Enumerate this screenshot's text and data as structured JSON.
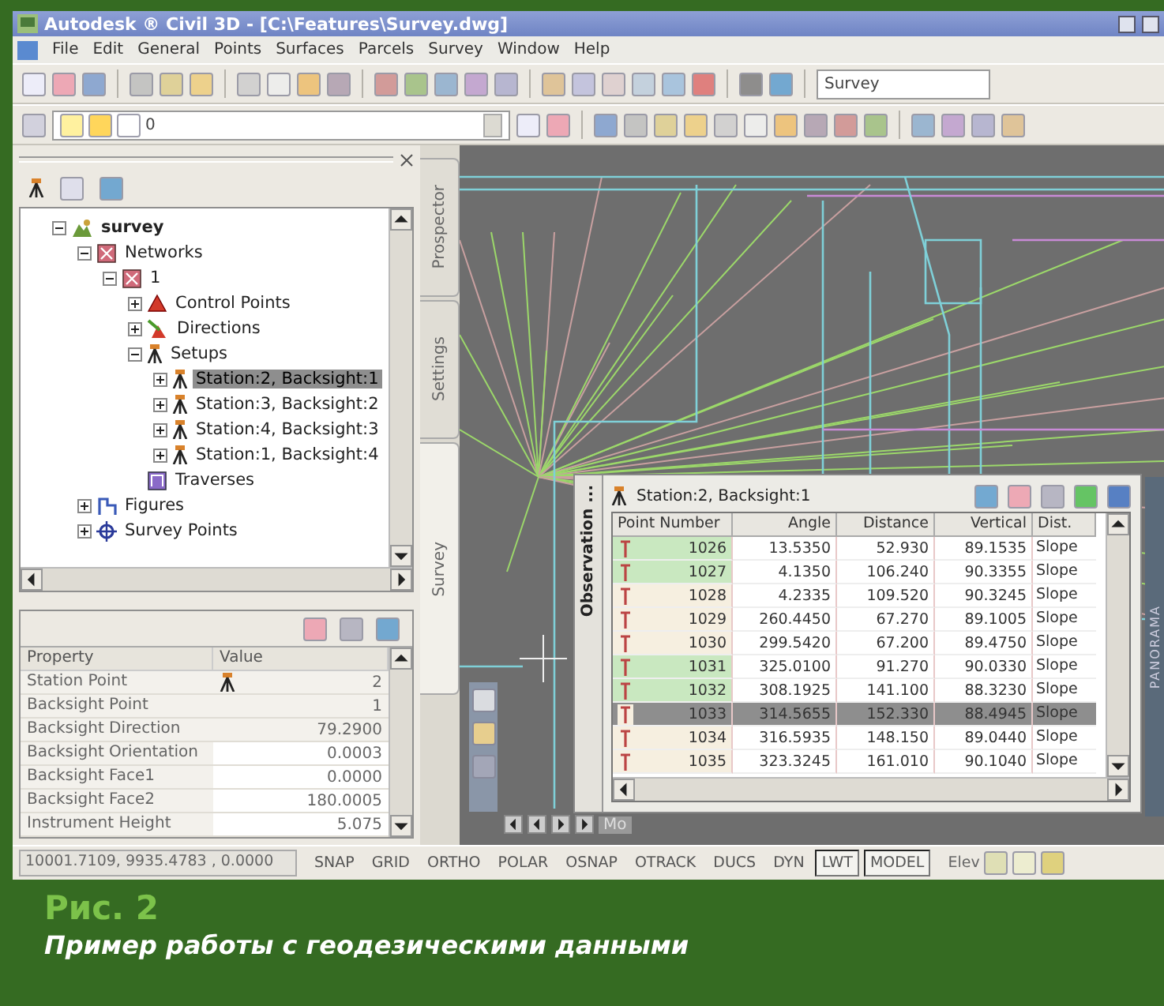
{
  "window": {
    "title": "Autodesk ® Civil 3D - [C:\\Features\\Survey.dwg]"
  },
  "menu": [
    "File",
    "Edit",
    "General",
    "Points",
    "Surfaces",
    "Parcels",
    "Survey",
    "Window",
    "Help"
  ],
  "toolbar": {
    "workspace": "Survey",
    "layer": "0"
  },
  "toolspace_tabs": [
    {
      "label": "Prospector",
      "selected": false
    },
    {
      "label": "Settings",
      "selected": false
    },
    {
      "label": "Survey",
      "selected": true
    }
  ],
  "tree": [
    {
      "label": "survey",
      "kind": "site",
      "expanded": true,
      "selected": false,
      "children": [
        {
          "label": "Networks",
          "kind": "network",
          "expanded": true,
          "selected": false,
          "children": [
            {
              "label": "1",
              "kind": "network",
              "expanded": true,
              "selected": false,
              "children": [
                {
                  "label": "Control Points",
                  "kind": "control",
                  "expanded": false,
                  "selected": false
                },
                {
                  "label": "Directions",
                  "kind": "directions",
                  "expanded": false,
                  "selected": false
                },
                {
                  "label": "Setups",
                  "kind": "setup",
                  "expanded": true,
                  "selected": false,
                  "children": [
                    {
                      "label": "Station:2, Backsight:1",
                      "kind": "setup",
                      "expanded": false,
                      "selected": true
                    },
                    {
                      "label": "Station:3, Backsight:2",
                      "kind": "setup",
                      "expanded": false,
                      "selected": false
                    },
                    {
                      "label": "Station:4, Backsight:3",
                      "kind": "setup",
                      "expanded": false,
                      "selected": false
                    },
                    {
                      "label": "Station:1, Backsight:4",
                      "kind": "setup",
                      "expanded": false,
                      "selected": false
                    }
                  ]
                },
                {
                  "label": "Traverses",
                  "kind": "traverse",
                  "selected": false
                }
              ]
            }
          ]
        },
        {
          "label": "Figures",
          "kind": "figures",
          "expanded": false,
          "selected": false
        },
        {
          "label": "Survey Points",
          "kind": "points",
          "expanded": false,
          "selected": false
        }
      ]
    }
  ],
  "properties": {
    "columns": [
      "Property",
      "Value"
    ],
    "rows": [
      {
        "property": "Station Point",
        "value": "2",
        "kind": "station",
        "editable": false
      },
      {
        "property": "Backsight Point",
        "value": "1",
        "kind": "plain",
        "editable": false
      },
      {
        "property": "Backsight Direction",
        "value": "79.2900",
        "kind": "plain",
        "editable": false
      },
      {
        "property": "Backsight Orientation",
        "value": "0.0003",
        "kind": "plain",
        "editable": true
      },
      {
        "property": "Backsight Face1",
        "value": "0.0000",
        "kind": "plain",
        "editable": true
      },
      {
        "property": "Backsight Face2",
        "value": "180.0005",
        "kind": "plain",
        "editable": true
      },
      {
        "property": "Instrument Height",
        "value": "5.075",
        "kind": "plain",
        "editable": true
      }
    ]
  },
  "observation": {
    "tab": "Observation ...",
    "title": "Station:2, Backsight:1",
    "columns": [
      "Point Number",
      "Angle",
      "Distance",
      "Vertical",
      "Dist."
    ],
    "rows": [
      {
        "cells": [
          "1026",
          "13.5350",
          "52.930",
          "89.1535",
          "Slope"
        ],
        "color": "#c9e8c0",
        "selected": false
      },
      {
        "cells": [
          "1027",
          "4.1350",
          "106.240",
          "90.3355",
          "Slope"
        ],
        "color": "#c9e8c0",
        "selected": false
      },
      {
        "cells": [
          "1028",
          "4.2335",
          "109.520",
          "90.3245",
          "Slope"
        ],
        "color": "#f6efe0",
        "selected": false
      },
      {
        "cells": [
          "1029",
          "260.4450",
          "67.270",
          "89.1005",
          "Slope"
        ],
        "color": "#f6efe0",
        "selected": false
      },
      {
        "cells": [
          "1030",
          "299.5420",
          "67.200",
          "89.4750",
          "Slope"
        ],
        "color": "#f6efe0",
        "selected": false
      },
      {
        "cells": [
          "1031",
          "325.0100",
          "91.270",
          "90.0330",
          "Slope"
        ],
        "color": "#c9e8c0",
        "selected": false
      },
      {
        "cells": [
          "1032",
          "308.1925",
          "141.100",
          "88.3230",
          "Slope"
        ],
        "color": "#c9e8c0",
        "selected": false
      },
      {
        "cells": [
          "1033",
          "314.5655",
          "152.330",
          "88.4945",
          "Slope"
        ],
        "color": "#f6efe0",
        "selected": true
      },
      {
        "cells": [
          "1034",
          "316.5935",
          "148.150",
          "89.0440",
          "Slope"
        ],
        "color": "#f6efe0",
        "selected": false
      },
      {
        "cells": [
          "1035",
          "323.3245",
          "161.010",
          "90.1040",
          "Slope"
        ],
        "color": "#f6efe0",
        "selected": false
      }
    ]
  },
  "side_panel": "PANORAMA",
  "layout_tab": "Mo",
  "status_bar": {
    "coordinates": "10001.7109, 9935.4783 , 0.0000",
    "toggles": [
      {
        "label": "SNAP",
        "on": false
      },
      {
        "label": "GRID",
        "on": false
      },
      {
        "label": "ORTHO",
        "on": false
      },
      {
        "label": "POLAR",
        "on": false
      },
      {
        "label": "OSNAP",
        "on": false
      },
      {
        "label": "OTRACK",
        "on": false
      },
      {
        "label": "DUCS",
        "on": false
      },
      {
        "label": "DYN",
        "on": false
      },
      {
        "label": "LWT",
        "on": true
      },
      {
        "label": "MODEL",
        "on": true
      }
    ],
    "elevation": "Elev"
  },
  "caption": {
    "figure": "Рис. 2",
    "text": "Пример работы с геодезическими данными"
  }
}
